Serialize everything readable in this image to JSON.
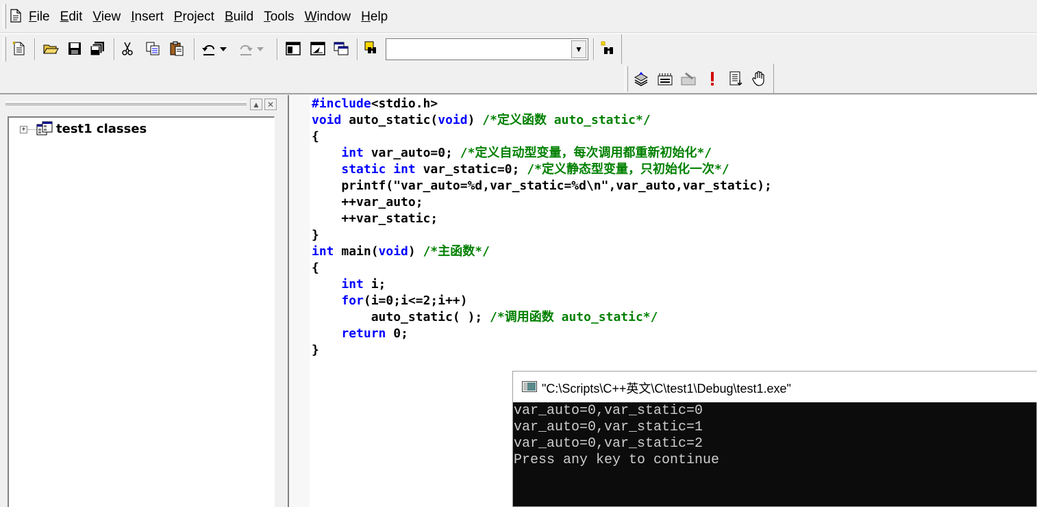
{
  "menubar": {
    "items": [
      {
        "hotkey": "F",
        "rest": "ile"
      },
      {
        "hotkey": "E",
        "rest": "dit"
      },
      {
        "hotkey": "V",
        "rest": "iew"
      },
      {
        "hotkey": "I",
        "rest": "nsert"
      },
      {
        "hotkey": "P",
        "rest": "roject"
      },
      {
        "hotkey": "B",
        "rest": "uild"
      },
      {
        "hotkey": "T",
        "rest": "ools"
      },
      {
        "hotkey": "W",
        "rest": "indow"
      },
      {
        "hotkey": "H",
        "rest": "elp"
      }
    ]
  },
  "toolbar": {
    "combo_value": "",
    "combo_arrow": "▼"
  },
  "workspace": {
    "tree_root": "test1 classes",
    "expander": "+",
    "minimize_glyph": "▲",
    "close_glyph": "✕"
  },
  "editor": {
    "lines": [
      [
        {
          "t": "#include",
          "c": "kw"
        },
        {
          "t": "<stdio.h>",
          "c": ""
        }
      ],
      [
        {
          "t": "void",
          "c": "kw"
        },
        {
          "t": " auto_static(",
          "c": ""
        },
        {
          "t": "void",
          "c": "kw"
        },
        {
          "t": ") ",
          "c": ""
        },
        {
          "t": "/*定义函数 auto_static*/",
          "c": "cm"
        }
      ],
      [
        {
          "t": "{",
          "c": ""
        }
      ],
      [
        {
          "t": "    ",
          "c": ""
        },
        {
          "t": "int",
          "c": "kw"
        },
        {
          "t": " var_auto=0; ",
          "c": ""
        },
        {
          "t": "/*定义自动型变量，每次调用都重新初始化*/",
          "c": "cm"
        }
      ],
      [
        {
          "t": "    ",
          "c": ""
        },
        {
          "t": "static",
          "c": "kw"
        },
        {
          "t": " ",
          "c": ""
        },
        {
          "t": "int",
          "c": "kw"
        },
        {
          "t": " var_static=0; ",
          "c": ""
        },
        {
          "t": "/*定义静态型变量，只初始化一次*/",
          "c": "cm"
        }
      ],
      [
        {
          "t": "    printf(\"var_auto=%d,var_static=%d\\n\",var_auto,var_static);",
          "c": ""
        }
      ],
      [
        {
          "t": "    ++var_auto;",
          "c": ""
        }
      ],
      [
        {
          "t": "    ++var_static;",
          "c": ""
        }
      ],
      [
        {
          "t": "}",
          "c": ""
        }
      ],
      [
        {
          "t": "int",
          "c": "kw"
        },
        {
          "t": " main(",
          "c": ""
        },
        {
          "t": "void",
          "c": "kw"
        },
        {
          "t": ") ",
          "c": ""
        },
        {
          "t": "/*主函数*/",
          "c": "cm"
        }
      ],
      [
        {
          "t": "{",
          "c": ""
        }
      ],
      [
        {
          "t": "    ",
          "c": ""
        },
        {
          "t": "int",
          "c": "kw"
        },
        {
          "t": " i;",
          "c": ""
        }
      ],
      [
        {
          "t": "    ",
          "c": ""
        },
        {
          "t": "for",
          "c": "kw"
        },
        {
          "t": "(i=0;i<=2;i++)",
          "c": ""
        }
      ],
      [
        {
          "t": "        auto_static( ); ",
          "c": ""
        },
        {
          "t": "/*调用函数 auto_static*/",
          "c": "cm"
        }
      ],
      [
        {
          "t": "    ",
          "c": ""
        },
        {
          "t": "return",
          "c": "kw"
        },
        {
          "t": " 0;",
          "c": ""
        }
      ],
      [
        {
          "t": "}",
          "c": ""
        }
      ]
    ]
  },
  "console": {
    "title": "\"C:\\Scripts\\C++英文\\C\\test1\\Debug\\test1.exe\"",
    "lines": [
      "var_auto=0,var_static=0",
      "var_auto=0,var_static=1",
      "var_auto=0,var_static=2",
      "Press any key to continue"
    ]
  },
  "colors": {
    "keyword": "#0000ff",
    "comment": "#008000",
    "console_bg": "#0c0c0c",
    "console_fg": "#cccccc"
  }
}
